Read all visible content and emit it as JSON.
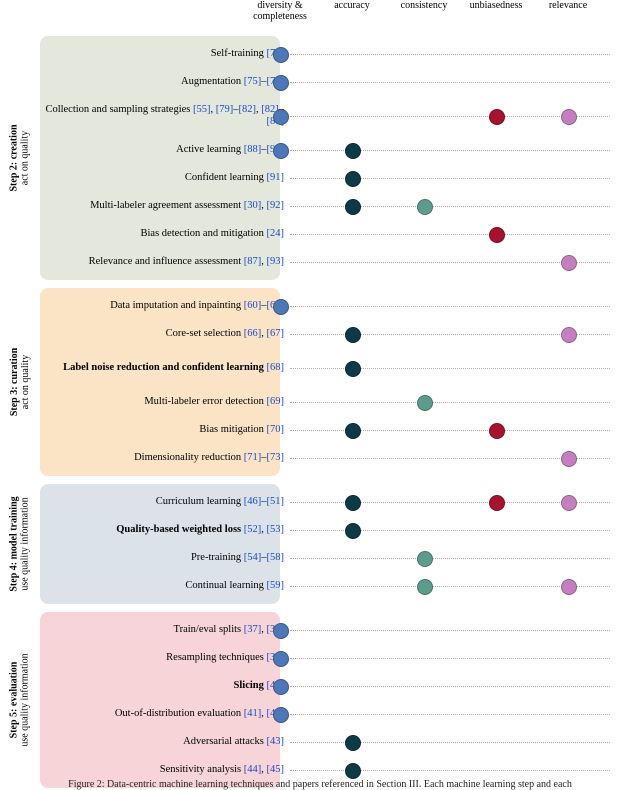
{
  "columns": [
    "diversity &\ncompleteness",
    "accuracy",
    "consistency",
    "unbiasedness",
    "relevance"
  ],
  "dot_color_keys": [
    "div",
    "acc",
    "con",
    "unb",
    "rel"
  ],
  "caption": "Figure 2: Data-centric machine learning techniques and papers referenced in Section III. Each machine learning step and each",
  "groups": [
    {
      "id": "grp2",
      "title": "Step 2: creation",
      "sub": "act on quality",
      "rows": [
        {
          "label": "Self-training ",
          "refs": "[74]",
          "dots": [
            "div"
          ]
        },
        {
          "label": "Augmentation ",
          "refs": "[75]–[78]",
          "dots": [
            "div"
          ]
        },
        {
          "label": "Collection and sampling strategies ",
          "refs": "[55], [79]–[82], [82]–[87]",
          "tall": true,
          "dots": [
            "div",
            "unb",
            "rel"
          ]
        },
        {
          "label": "Active learning ",
          "refs": "[88]–[90]",
          "dots": [
            "div",
            "acc"
          ]
        },
        {
          "label": "Confident learning ",
          "refs": "[91]",
          "dots": [
            "acc"
          ]
        },
        {
          "label": "Multi-labeler agreement assessment ",
          "refs": "[30], [92]",
          "dots": [
            "acc",
            "con"
          ]
        },
        {
          "label": "Bias detection and mitigation ",
          "refs": "[24]",
          "dots": [
            "unb"
          ]
        },
        {
          "label": "Relevance and influence assessment ",
          "refs": "[87], [93]",
          "dots": [
            "rel"
          ]
        }
      ]
    },
    {
      "id": "grp3",
      "title": "Step 3: curation",
      "sub": "act on quality",
      "rows": [
        {
          "label": "Data imputation and inpainting ",
          "refs": "[60]–[65]",
          "dots": [
            "div"
          ]
        },
        {
          "label": "Core-set selection ",
          "refs": "[66], [67]",
          "dots": [
            "acc",
            "rel"
          ]
        },
        {
          "bold": true,
          "label": "Label noise reduction and confident learning ",
          "refs": "[68]",
          "tall": true,
          "dots": [
            "acc"
          ]
        },
        {
          "label": "Multi-labeler error detection ",
          "refs": "[69]",
          "dots": [
            "con"
          ]
        },
        {
          "label": "Bias mitigation ",
          "refs": "[70]",
          "dots": [
            "acc",
            "unb"
          ]
        },
        {
          "label": "Dimensionality reduction ",
          "refs": "[71]–[73]",
          "dots": [
            "rel"
          ]
        }
      ]
    },
    {
      "id": "grp4",
      "title": "Step 4: model training",
      "sub": "use quality information",
      "rows": [
        {
          "label": "Curriculum learning ",
          "refs": "[46]–[51]",
          "dots": [
            "acc",
            "unb",
            "rel"
          ]
        },
        {
          "bold": true,
          "label": "Quality-based weighted loss ",
          "refs": "[52], [53]",
          "dots": [
            "acc"
          ]
        },
        {
          "label": "Pre-training ",
          "refs": "[54]–[58]",
          "dots": [
            "con"
          ]
        },
        {
          "label": "Continual learning ",
          "refs": "[59]",
          "dots": [
            "con",
            "rel"
          ]
        }
      ]
    },
    {
      "id": "grp5",
      "title": "Step 5: evaluation",
      "sub": "use quality information",
      "rows": [
        {
          "label": "Train/eval splits ",
          "refs": "[37], [38]",
          "dots": [
            "div"
          ]
        },
        {
          "label": "Resampling techniques ",
          "refs": "[39]",
          "dots": [
            "div"
          ]
        },
        {
          "bold": true,
          "label": "Slicing ",
          "refs": "[40]",
          "dots": [
            "div"
          ]
        },
        {
          "label": "Out-of-distribution evaluation ",
          "refs": "[41], [42]",
          "dots": [
            "div"
          ]
        },
        {
          "label": "Adversarial attacks ",
          "refs": "[43]",
          "dots": [
            "acc"
          ]
        },
        {
          "label": "Sensitivity analysis ",
          "refs": "[44], [45]",
          "dots": [
            "acc"
          ]
        }
      ]
    }
  ],
  "chart_data": {
    "type": "heatmap",
    "xlabel": "",
    "ylabel": "",
    "categories_x": [
      "diversity & completeness",
      "accuracy",
      "consistency",
      "unbiasedness",
      "relevance"
    ],
    "categories_y": [
      "Self-training",
      "Augmentation",
      "Collection and sampling strategies",
      "Active learning",
      "Confident learning",
      "Multi-labeler agreement assessment",
      "Bias detection and mitigation",
      "Relevance and influence assessment",
      "Data imputation and inpainting",
      "Core-set selection",
      "Label noise reduction and confident learning",
      "Multi-labeler error detection",
      "Bias mitigation",
      "Dimensionality reduction",
      "Curriculum learning",
      "Quality-based weighted loss",
      "Pre-training",
      "Continual learning",
      "Train/eval splits",
      "Resampling techniques",
      "Slicing",
      "Out-of-distribution evaluation",
      "Adversarial attacks",
      "Sensitivity analysis"
    ],
    "values_binary": [
      [
        1,
        0,
        0,
        0,
        0
      ],
      [
        1,
        0,
        0,
        0,
        0
      ],
      [
        1,
        0,
        0,
        1,
        1
      ],
      [
        1,
        1,
        0,
        0,
        0
      ],
      [
        0,
        1,
        0,
        0,
        0
      ],
      [
        0,
        1,
        1,
        0,
        0
      ],
      [
        0,
        0,
        0,
        1,
        0
      ],
      [
        0,
        0,
        0,
        0,
        1
      ],
      [
        1,
        0,
        0,
        0,
        0
      ],
      [
        0,
        1,
        0,
        0,
        1
      ],
      [
        0,
        1,
        0,
        0,
        0
      ],
      [
        0,
        0,
        1,
        0,
        0
      ],
      [
        0,
        1,
        0,
        1,
        0
      ],
      [
        0,
        0,
        0,
        0,
        1
      ],
      [
        0,
        1,
        0,
        1,
        1
      ],
      [
        0,
        1,
        0,
        0,
        0
      ],
      [
        0,
        0,
        1,
        0,
        0
      ],
      [
        0,
        0,
        1,
        0,
        1
      ],
      [
        1,
        0,
        0,
        0,
        0
      ],
      [
        1,
        0,
        0,
        0,
        0
      ],
      [
        1,
        0,
        0,
        0,
        0
      ],
      [
        1,
        0,
        0,
        0,
        0
      ],
      [
        0,
        1,
        0,
        0,
        0
      ],
      [
        0,
        1,
        0,
        0,
        0
      ]
    ],
    "group_boundaries": {
      "Step 2: creation": [
        0,
        7
      ],
      "Step 3: curation": [
        8,
        13
      ],
      "Step 4: model training": [
        14,
        17
      ],
      "Step 5: evaluation": [
        18,
        23
      ]
    }
  }
}
